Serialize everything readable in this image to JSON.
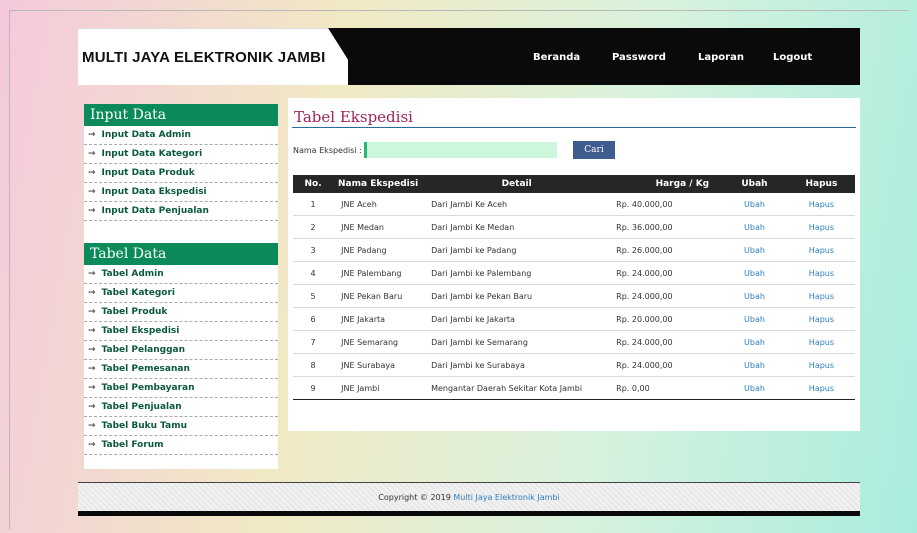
{
  "header": {
    "brand": "MULTI JAYA ELEKTRONIK JAMBI",
    "nav": [
      "Beranda",
      "Password",
      "Laporan",
      "Logout"
    ]
  },
  "sidebar": {
    "input_title": "Input Data",
    "input_items": [
      "Input Data Admin",
      "Input Data Kategori",
      "Input Data Produk",
      "Input Data Ekspedisi",
      "Input Data Penjualan"
    ],
    "table_title": "Tabel Data",
    "table_items": [
      "Tabel Admin",
      "Tabel Kategori",
      "Tabel Produk",
      "Tabel Ekspedisi",
      "Tabel Pelanggan",
      "Tabel Pemesanan",
      "Tabel Pembayaran",
      "Tabel Penjualan",
      "Tabel Buku Tamu",
      "Tabel Forum"
    ],
    "arrow": "→"
  },
  "main": {
    "title": "Tabel Ekspedisi",
    "search_label": "Nama Ekspedisi :",
    "search_value": "",
    "search_button": "Cari",
    "columns": [
      "No.",
      "Nama Ekspedisi",
      "Detail",
      "Harga / Kg",
      "Ubah",
      "Hapus"
    ],
    "rows": [
      {
        "no": "1",
        "nama": "JNE Aceh",
        "detail": "Dari Jambi Ke Aceh",
        "harga": "Rp. 40.000,00",
        "ubah": "Ubah",
        "hapus": "Hapus"
      },
      {
        "no": "2",
        "nama": "JNE Medan",
        "detail": "Dari Jambi Ke Medan",
        "harga": "Rp. 36.000,00",
        "ubah": "Ubah",
        "hapus": "Hapus"
      },
      {
        "no": "3",
        "nama": "JNE Padang",
        "detail": "Dari Jambi ke Padang",
        "harga": "Rp. 26.000,00",
        "ubah": "Ubah",
        "hapus": "Hapus"
      },
      {
        "no": "4",
        "nama": "JNE Palembang",
        "detail": "Dari Jambi ke Palembang",
        "harga": "Rp. 24.000,00",
        "ubah": "Ubah",
        "hapus": "Hapus"
      },
      {
        "no": "5",
        "nama": "JNE Pekan Baru",
        "detail": "Dari Jambi ke Pekan Baru",
        "harga": "Rp. 24.000,00",
        "ubah": "Ubah",
        "hapus": "Hapus"
      },
      {
        "no": "6",
        "nama": "JNE Jakarta",
        "detail": "Dari Jambi ke Jakarta",
        "harga": "Rp. 20.000,00",
        "ubah": "Ubah",
        "hapus": "Hapus"
      },
      {
        "no": "7",
        "nama": "JNE Semarang",
        "detail": "Dari Jambi ke Semarang",
        "harga": "Rp. 24.000,00",
        "ubah": "Ubah",
        "hapus": "Hapus"
      },
      {
        "no": "8",
        "nama": "JNE Surabaya",
        "detail": "Dari Jambi ke Surabaya",
        "harga": "Rp. 24.000,00",
        "ubah": "Ubah",
        "hapus": "Hapus"
      },
      {
        "no": "9",
        "nama": "JNE Jambi",
        "detail": "Mengantar Daerah Sekitar Kota Jambi",
        "harga": "Rp. 0,00",
        "ubah": "Ubah",
        "hapus": "Hapus"
      }
    ]
  },
  "footer": {
    "prefix": "Copyright © 2019",
    "link": "Multi Jaya Elektronik Jambi"
  }
}
